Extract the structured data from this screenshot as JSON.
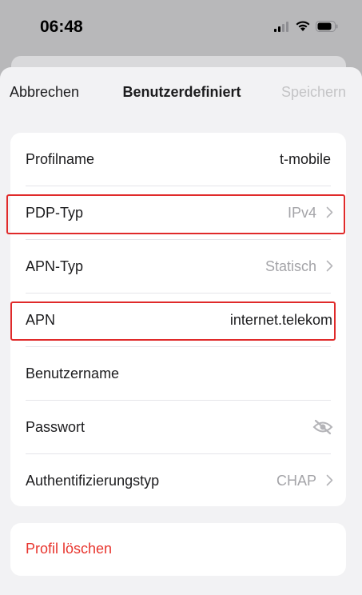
{
  "status_bar": {
    "time": "06:48",
    "icons": [
      "signal-icon",
      "wifi-icon",
      "battery-icon"
    ]
  },
  "nav": {
    "cancel_label": "Abbrechen",
    "title": "Benutzerdefiniert",
    "save_label": "Speichern"
  },
  "settings": {
    "profile_name": {
      "label": "Profilname",
      "value": "t-mobile"
    },
    "pdp_type": {
      "label": "PDP-Typ",
      "value": "IPv4"
    },
    "apn_type": {
      "label": "APN-Typ",
      "value": "Statisch"
    },
    "apn": {
      "label": "APN",
      "value": "internet.telekom"
    },
    "username": {
      "label": "Benutzername",
      "value": ""
    },
    "password": {
      "label": "Passwort",
      "value": ""
    },
    "auth_type": {
      "label": "Authentifizierungstyp",
      "value": "CHAP"
    }
  },
  "delete": {
    "label": "Profil löschen"
  },
  "colors": {
    "highlight": "#e02a2a",
    "destructive": "#e8352e",
    "muted": "#a4a4a8"
  }
}
